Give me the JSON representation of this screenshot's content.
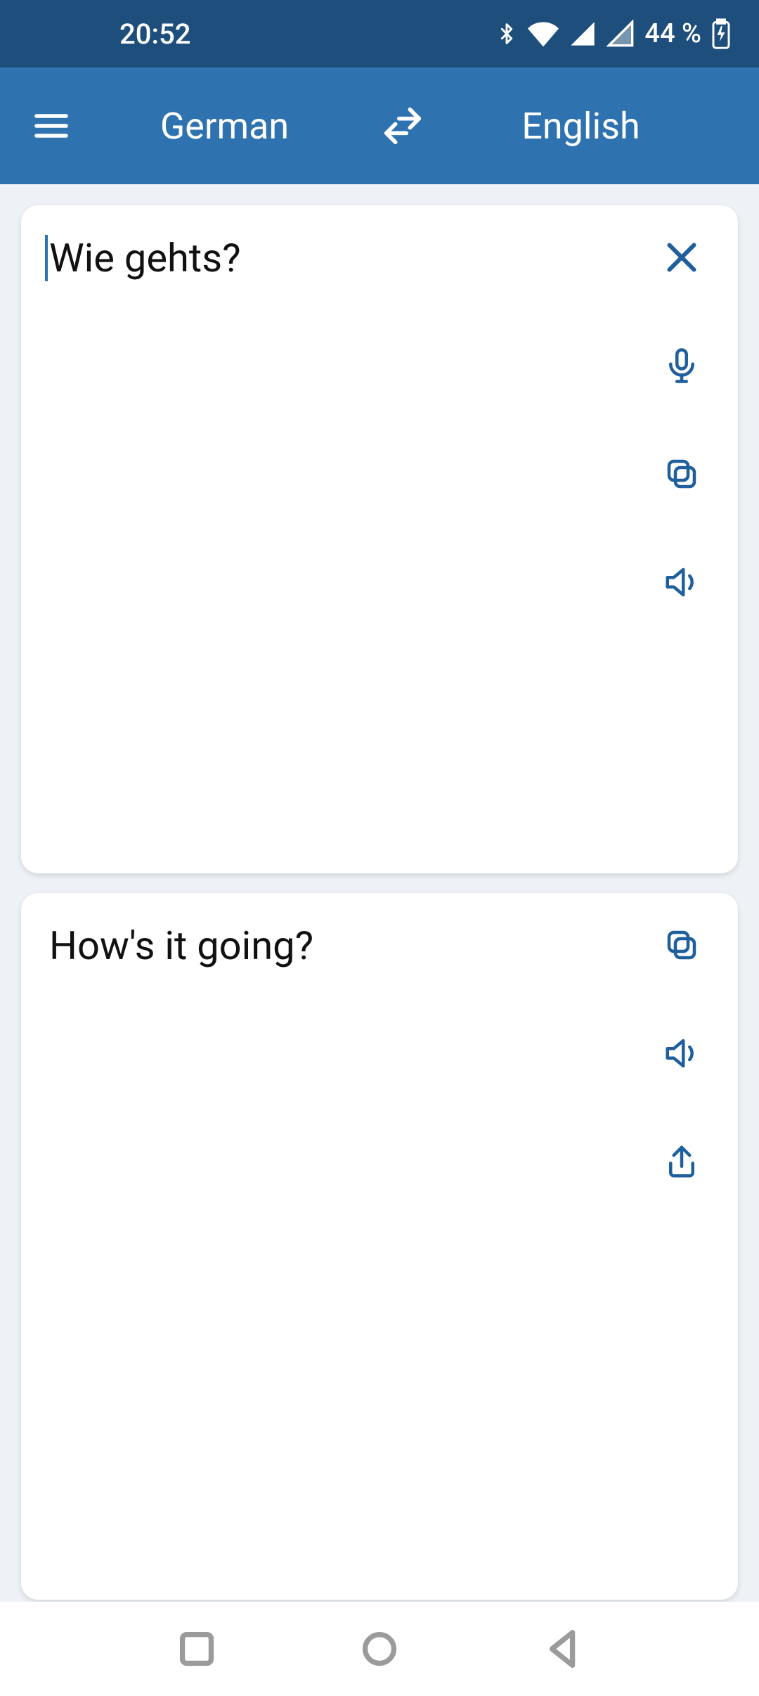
{
  "status": {
    "time": "20:52",
    "battery": "44 %"
  },
  "appbar": {
    "source_lang": "German",
    "target_lang": "English"
  },
  "input": {
    "text": "Wie gehts?"
  },
  "output": {
    "text": "How's it going?"
  }
}
